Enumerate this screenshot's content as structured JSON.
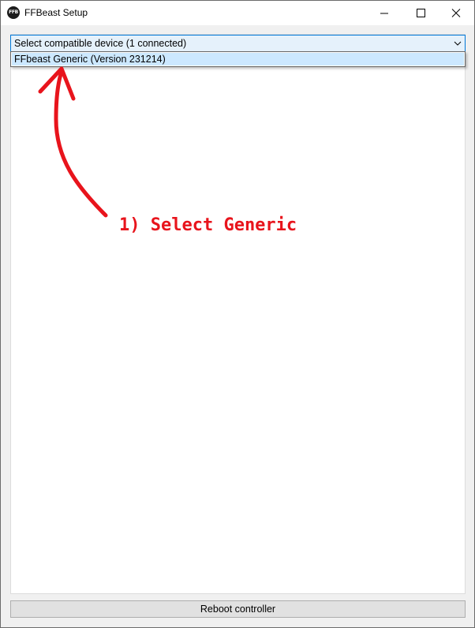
{
  "window": {
    "title": "FFBeast Setup",
    "icon_text": "FFB"
  },
  "device_combo": {
    "selected_text": "Select compatible device (1 connected)",
    "options": [
      "FFbeast Generic (Version 231214)"
    ]
  },
  "actions": {
    "reboot_label": "Reboot controller"
  },
  "annotation": {
    "text": "1) Select Generic",
    "color": "#e8141c"
  },
  "icons": {
    "minimize": "minimize-icon",
    "maximize": "maximize-icon",
    "close": "close-icon",
    "dropdown": "chevron-down-icon",
    "app": "app-logo-icon"
  },
  "colors": {
    "selection_highlight": "#cce8ff",
    "focus_border": "#0078d7",
    "combo_background": "#e5f1fb"
  }
}
